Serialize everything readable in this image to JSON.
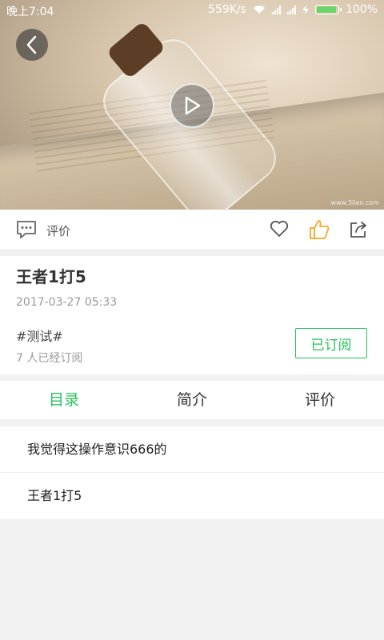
{
  "status_bar": {
    "time": "晚上7:04",
    "network_speed": "559K/s",
    "battery_percent": "100%",
    "battery_level": 1.0
  },
  "hero": {
    "watermark": "www.3lian.com",
    "icons": {
      "back": "chevron-left-icon",
      "play": "play-icon"
    }
  },
  "action_bar": {
    "comment_label": "评价",
    "icons": [
      "comment-icon",
      "heart-icon",
      "thumbs-up-icon",
      "share-icon"
    ],
    "thumbs_up_color": "#f5a623"
  },
  "article": {
    "title": "王者1打5",
    "date": "2017-03-27 05:33",
    "tag": "#测试#",
    "subscribers": "7 人已经订阅",
    "subscribe_button": "已订阅"
  },
  "tabs": [
    {
      "label": "目录",
      "active": true
    },
    {
      "label": "简介",
      "active": false
    },
    {
      "label": "评价",
      "active": false
    }
  ],
  "catalog": [
    "我觉得这操作意识666的",
    "王者1打5"
  ],
  "colors": {
    "accent": "#27c25c",
    "background": "#f2f2f2"
  }
}
